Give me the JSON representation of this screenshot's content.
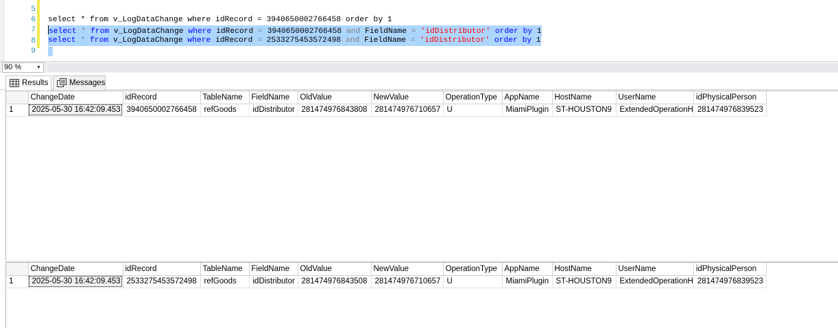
{
  "editor": {
    "lines": [
      {
        "num": "5",
        "code": "select * from v_LogDataChange where idRecord = 3940650002766458 order by 1"
      },
      {
        "num": "6",
        "select_kw": "select",
        "star": "*",
        "from_kw": "from",
        "table": "v_LogDataChange",
        "where_kw": "where",
        "col1": "idRecord",
        "eq": "=",
        "val1": "3940650002766458",
        "and_kw": "and",
        "col2": "FieldName",
        "eq2": "=",
        "val2": "'idDistributor'",
        "order_kw": "order by",
        "order_val": "1"
      },
      {
        "num": "7",
        "select_kw": "select",
        "star": "*",
        "from_kw": "from",
        "table": "v_LogDataChange",
        "where_kw": "where",
        "col1": "idRecord",
        "eq": "=",
        "val1": "2533275453572498",
        "and_kw": "and",
        "col2": "FieldName",
        "eq2": "=",
        "val2": "'idDistributor'",
        "order_kw": "order by",
        "order_val": "1"
      },
      {
        "num": "8"
      },
      {
        "num": "9"
      }
    ]
  },
  "zoom": {
    "value": "90 %"
  },
  "tabs": [
    {
      "label": "Results",
      "icon": "grid-icon"
    },
    {
      "label": "Messages",
      "icon": "messages-icon"
    }
  ],
  "grid": {
    "columns": [
      "ChangeDate",
      "idRecord",
      "TableName",
      "FieldName",
      "OldValue",
      "NewValue",
      "OperationType",
      "AppName",
      "HostName",
      "UserName",
      "idPhysicalPerson"
    ],
    "results": [
      {
        "rows": [
          {
            "num": "1",
            "cells": [
              "2025-05-30 16:42:09.453",
              "3940650002766458",
              "refGoods",
              "idDistributor",
              "281474976843808",
              "281474976710657",
              "U",
              "MiamiPlugin",
              "ST-HOUSTON9",
              "ExtendedOperationH",
              "281474976839523"
            ]
          }
        ]
      },
      {
        "rows": [
          {
            "num": "1",
            "cells": [
              "2025-05-30 16:42:09.453",
              "2533275453572498",
              "refGoods",
              "idDistributor",
              "281474976843508",
              "281474976710657",
              "U",
              "MiamiPlugin",
              "ST-HOUSTON9",
              "ExtendedOperationH",
              "281474976839523"
            ]
          }
        ]
      }
    ]
  }
}
